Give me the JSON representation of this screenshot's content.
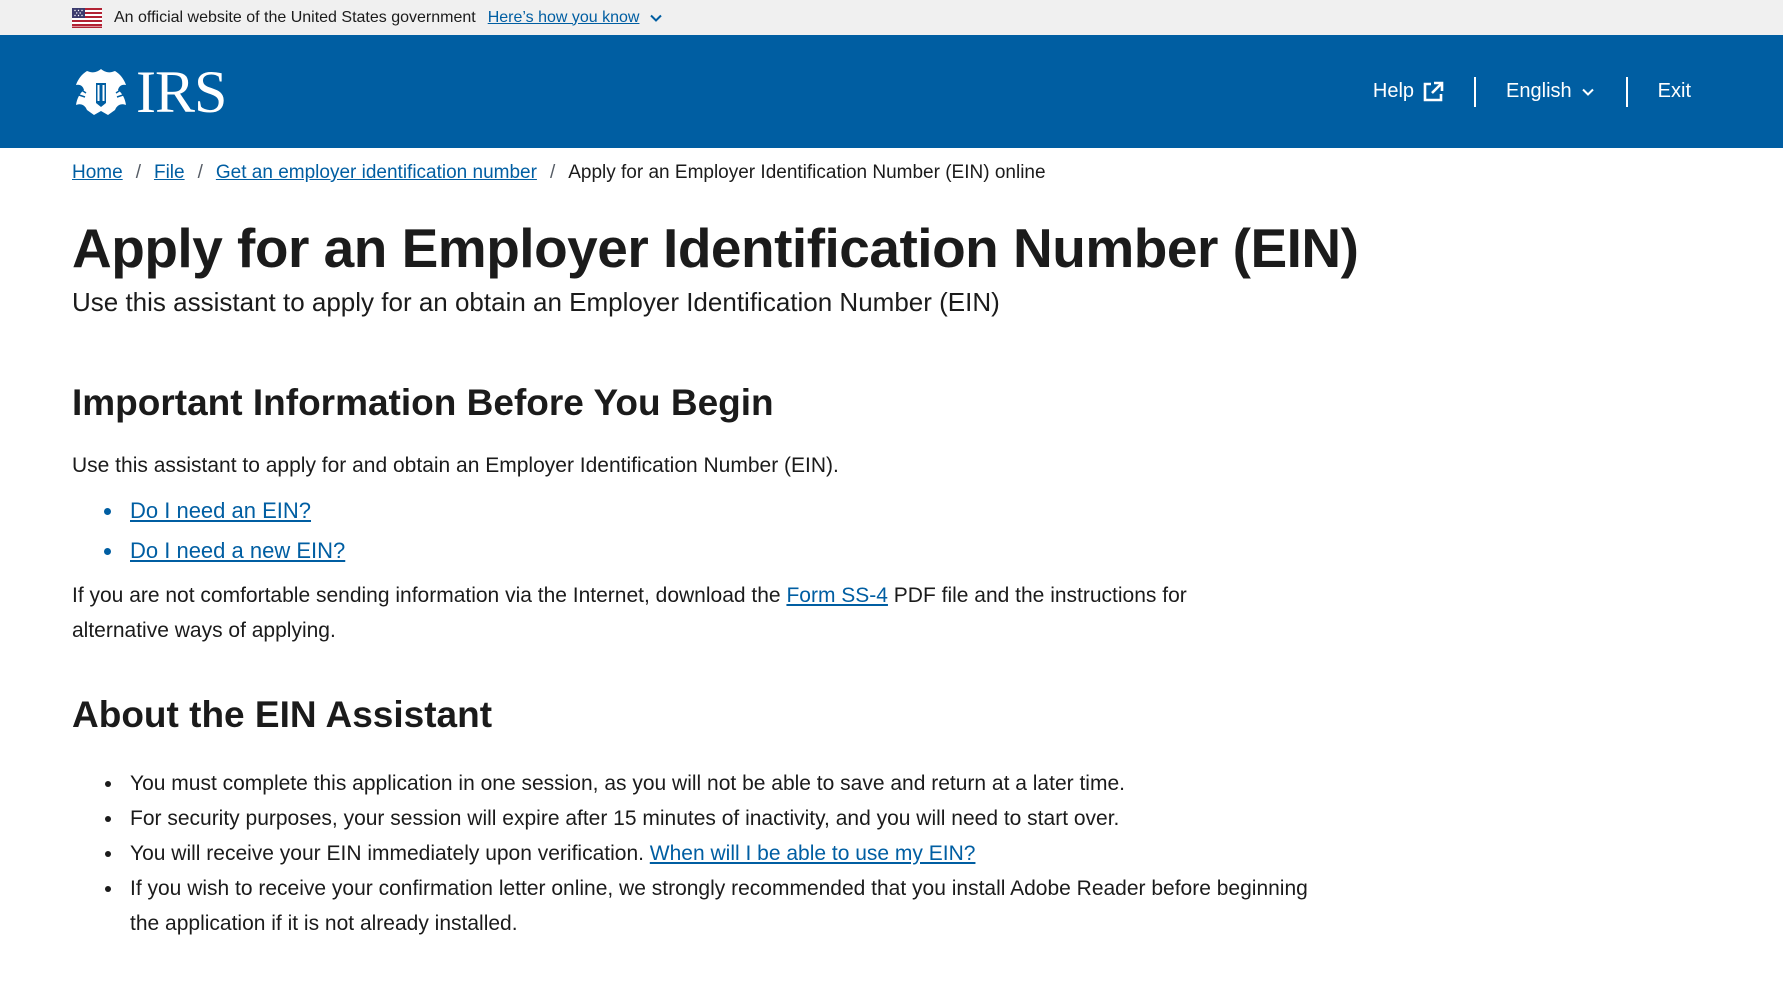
{
  "gov_banner": {
    "text": "An official website of the United States government",
    "how_link": "Here’s how you know"
  },
  "header": {
    "logo_text": "IRS",
    "nav": {
      "help": "Help",
      "language": "English",
      "exit": "Exit"
    }
  },
  "breadcrumb": {
    "items": [
      "Home",
      "File",
      "Get an employer identification number"
    ],
    "current": "Apply for an Employer Identification Number (EIN) online",
    "separator": "/"
  },
  "main": {
    "title": "Apply for an Employer Identification Number (EIN)",
    "subtitle": "Use this assistant to apply for an obtain an Employer Identification Number (EIN)",
    "section1": {
      "heading": "Important Information Before You Begin",
      "intro": "Use this assistant to apply for and obtain an Employer Identification Number (EIN).",
      "links": [
        "Do I need an EIN?",
        "Do I need a new EIN?"
      ],
      "para_before": "If you are not comfortable sending information via the Internet, download the ",
      "para_link": "Form SS-4",
      "para_after": " PDF file and the instructions for alternative ways of applying."
    },
    "section2": {
      "heading": "About the EIN Assistant",
      "bullets": [
        "You must complete this application in one session, as you will not be able to save and return at a later time.",
        "For security purposes, your session will expire after 15 minutes of inactivity, and you will need to start over.",
        "You will receive your EIN immediately upon verification. ",
        "If you wish to receive your confirmation letter online, we strongly recommended that you install Adobe Reader before beginning the application if it is not already installed."
      ],
      "bullet3_link": "When will I be able to use my EIN?"
    }
  },
  "colors": {
    "header_bg": "#005ea2",
    "link": "#005ea2",
    "banner_bg": "#f0f0f0"
  }
}
